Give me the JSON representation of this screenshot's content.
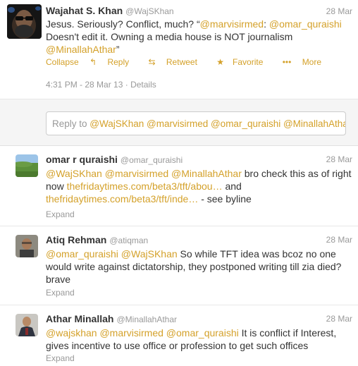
{
  "main_tweet": {
    "name": "Wajahat S. Khan",
    "handle": "@WajSKhan",
    "date": "28 Mar",
    "line1_prefix": "Jesus. Seriously? Conflict, much? “",
    "mention1": "@marvisirmed",
    "colon": ": ",
    "mention2": "@omar_quraishi",
    "line2": "Doesn't edit it. Owning a media house is NOT journalism",
    "mention3": "@MinallahAthar",
    "quote_end": "”",
    "actions": {
      "collapse": "Collapse",
      "reply": "Reply",
      "retweet": "Retweet",
      "favorite": "Favorite",
      "more": "More"
    },
    "meta_time": "4:31 PM - 28 Mar 13",
    "meta_sep": " · ",
    "meta_details": "Details"
  },
  "reply_box": {
    "prefix": "Reply to ",
    "mentions": "@WajSKhan @marvisirmed @omar_quraishi @MinallahAthar"
  },
  "replies": [
    {
      "name": "omar r quraishi",
      "handle": "@omar_quraishi",
      "date": "28 Mar",
      "mentions": "@WajSKhan @marvisirmed @MinallahAthar",
      "t1": " bro check this as of right",
      "t2a": "now  ",
      "link1": "thefridaytimes.com/beta3/tft/abou…",
      "t2b": " and",
      "link2": "thefridaytimes.com/beta3/tft/inde…",
      "t3": " - see byline",
      "expand": "Expand"
    },
    {
      "name": "Atiq Rehman",
      "handle": "@atiqman",
      "date": "28 Mar",
      "mentions": "@omar_quraishi @WajSKhan",
      "t1": " So while TFT idea was bcoz no one",
      "t2": "would write against dictatorship, they postponed writing till zia died?",
      "t3": "brave",
      "expand": "Expand"
    },
    {
      "name": "Athar Minallah",
      "handle": "@MinallahAthar",
      "date": "28 Mar",
      "mentions": "@wajskhan @marvisirmed @omar_quraishi",
      "t1": " It is conflict if Interest,",
      "t2": "gives incentive to use office or profession to get such offices",
      "expand": "Expand"
    }
  ],
  "colors": {
    "link": "#d4a12a",
    "muted": "#999999",
    "text": "#333333",
    "reply_bg": "#f5f5f5"
  }
}
